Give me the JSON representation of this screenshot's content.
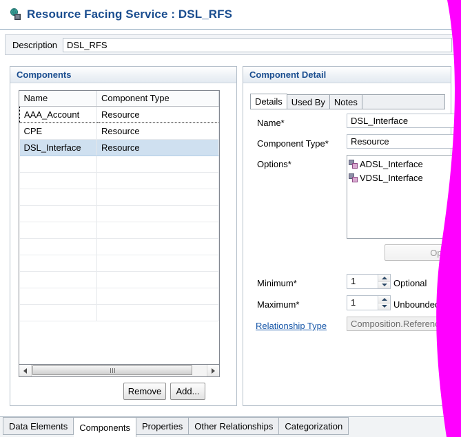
{
  "window": {
    "title": "Resource Facing Service : DSL_RFS",
    "title_icon": "resource-facing-service-icon",
    "title_color": "#1a4d8f"
  },
  "description": {
    "label": "Description",
    "value": "DSL_RFS",
    "placeholder": ""
  },
  "components_panel": {
    "header": "Components",
    "table": {
      "columns": [
        "Name",
        "Component Type"
      ],
      "rows": [
        {
          "name": "AAA_Account",
          "type": "Resource",
          "state": "focused"
        },
        {
          "name": "CPE",
          "type": "Resource",
          "state": "normal"
        },
        {
          "name": "DSL_Interface",
          "type": "Resource",
          "state": "selected"
        }
      ],
      "empty_row_count": 10
    },
    "scrollbar": {
      "left_arrow_icon": "arrow-left-icon",
      "right_arrow_icon": "arrow-right-icon",
      "grip_icon": "grip-icon"
    },
    "buttons": {
      "remove": "Remove",
      "add": "Add..."
    }
  },
  "detail_panel": {
    "header": "Component Detail",
    "tabs": [
      {
        "label": "Details",
        "active": true
      },
      {
        "label": "Used By",
        "active": false
      },
      {
        "label": "Notes",
        "active": false
      }
    ],
    "fields": {
      "name_label": "Name*",
      "name_value": "DSL_Interface",
      "component_type_label": "Component Type*",
      "component_type_value": "Resource",
      "options_label": "Options*",
      "options": [
        {
          "label": "ADSL_Interface",
          "icon": "component-icon"
        },
        {
          "label": "VDSL_Interface",
          "icon": "component-icon"
        }
      ],
      "open_button": "Open",
      "open_button_disabled": true,
      "minimum_label": "Minimum*",
      "minimum_value": "1",
      "minimum_extra": "Optional",
      "maximum_label": "Maximum*",
      "maximum_value": "1",
      "maximum_extra": "Unbounded",
      "relationship_type_link": "Relationship Type",
      "relationship_type_value": "Composition.Reference"
    }
  },
  "bottom_tabs": [
    {
      "label": "Data Elements",
      "active": false
    },
    {
      "label": "Components",
      "active": true
    },
    {
      "label": "Properties",
      "active": false
    },
    {
      "label": "Other Relationships",
      "active": false
    },
    {
      "label": "Categorization",
      "active": false
    }
  ],
  "overlay": {
    "name": "magenta-arc-overlay",
    "color": "#FF00FF"
  }
}
